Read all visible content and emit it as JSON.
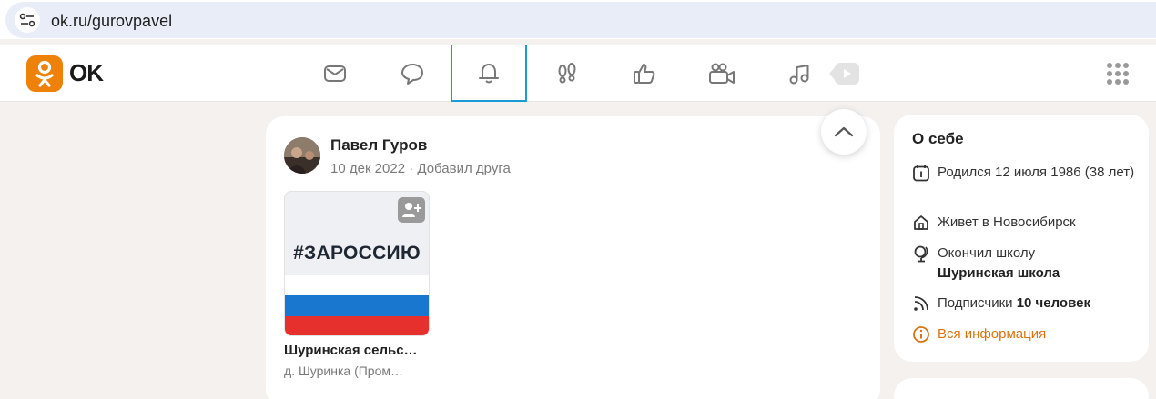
{
  "browser": {
    "url": "ok.ru/gurovpavel"
  },
  "brand": {
    "logo_text": "OK",
    "accent": "#ee8208",
    "active_tab_color": "#1a9bd8"
  },
  "nav": {
    "items": [
      {
        "name": "messages",
        "icon": "envelope-icon"
      },
      {
        "name": "discussions",
        "icon": "speech-bubble-icon"
      },
      {
        "name": "notifications",
        "icon": "bell-icon",
        "active": true
      },
      {
        "name": "guests",
        "icon": "footprints-icon"
      },
      {
        "name": "events",
        "icon": "thumbs-up-icon"
      },
      {
        "name": "video",
        "icon": "camera-icon"
      },
      {
        "name": "music",
        "icon": "music-note-icon"
      }
    ]
  },
  "post": {
    "author": "Павел Гуров",
    "meta": "10 дек 2022 · Добавил друга",
    "group": {
      "thumb_text": "#ЗАРОССИЮ",
      "name": "Шуринская сельс…",
      "location": "д. Шуринка (Пром…"
    }
  },
  "about": {
    "title": "О себе",
    "born_line": "Родился 12 июля 1986 (38 лет)",
    "lives": "Живет в Новосибирск",
    "school_label": "Окончил школу",
    "school_name": "Шуринская школа",
    "subscribers_label": "Подписчики",
    "subscribers_value": "10 человек",
    "all_info": "Вся информация"
  }
}
